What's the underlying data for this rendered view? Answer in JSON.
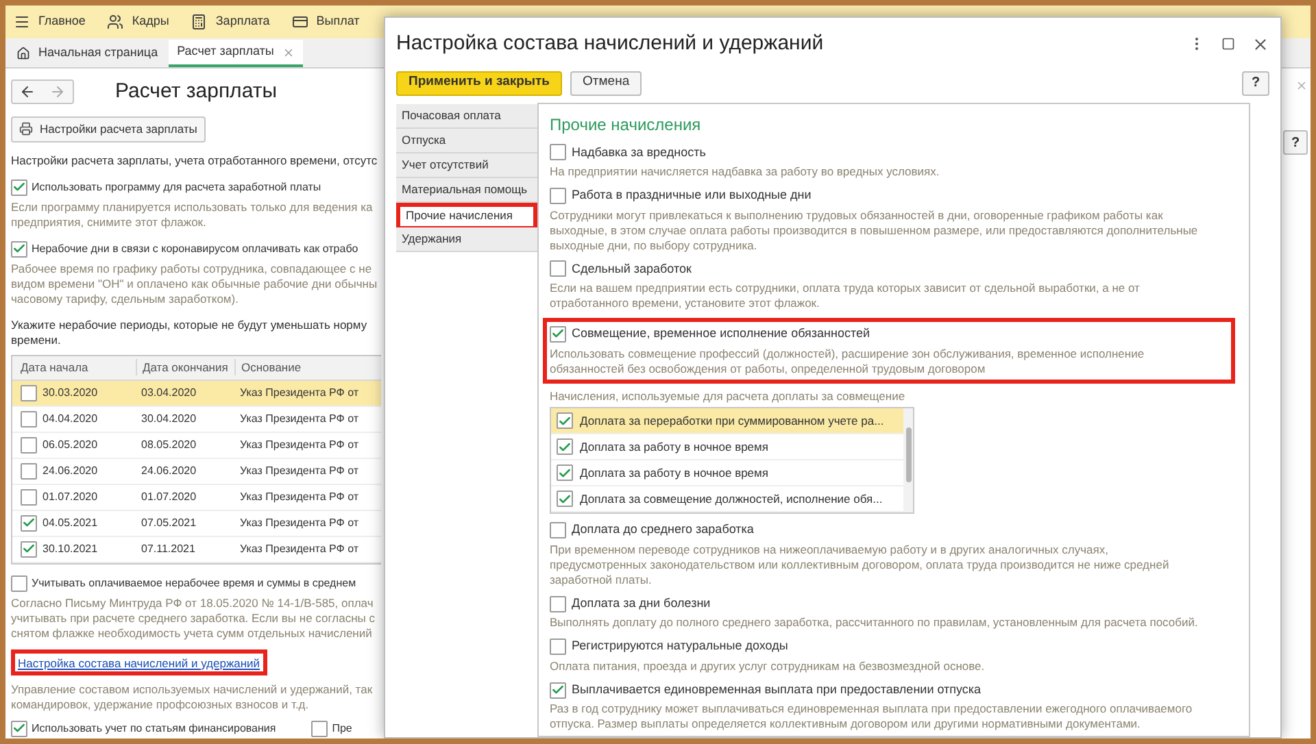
{
  "menu": [
    {
      "label": "Главное"
    },
    {
      "label": "Кадры"
    },
    {
      "label": "Зарплата"
    },
    {
      "label": "Выплат"
    }
  ],
  "tabs": [
    {
      "label": "Начальная страница",
      "selected": false
    },
    {
      "label": "Расчет зарплаты",
      "selected": true
    }
  ],
  "page": {
    "title": "Расчет зарплаты",
    "settings_button": "Настройки расчета зарплаты",
    "blocks": [
      {
        "kind": "text",
        "lines": [
          "Настройки расчета зарплаты, учета отработанного времени, отсутс"
        ]
      },
      {
        "kind": "checkbox",
        "label": "Использовать программу для расчета заработной платы",
        "checked": true,
        "hint": [
          "Если программу планируется использовать только для ведения ка",
          "предприятия, снимите этот флажок."
        ]
      },
      {
        "kind": "checkbox",
        "label": "Нерабочие дни в связи с коронавирусом оплачивать как отрабо",
        "checked": true,
        "hint": [
          "Рабочее время по графику работы сотрудника, совпадающее с не",
          "видом времени \"ОН\" и оплачено как обычные рабочие дни обычны",
          "часовому тарифу, сдельным заработком)."
        ]
      },
      {
        "kind": "text",
        "lines": [
          "Укажите нерабочие периоды, которые не будут уменьшать норму",
          "времени."
        ]
      },
      {
        "kind": "table",
        "columns": [
          "Дата начала",
          "Дата окончания",
          "Основание"
        ],
        "rows": [
          {
            "checked": false,
            "selected": true,
            "cells": [
              "30.03.2020",
              "03.04.2020",
              "Указ Президента РФ от"
            ]
          },
          {
            "checked": false,
            "selected": false,
            "cells": [
              "04.04.2020",
              "30.04.2020",
              "Указ Президента РФ от"
            ]
          },
          {
            "checked": false,
            "selected": false,
            "cells": [
              "06.05.2020",
              "08.05.2020",
              "Указ Президента РФ от"
            ]
          },
          {
            "checked": false,
            "selected": false,
            "cells": [
              "24.06.2020",
              "24.06.2020",
              "Указ Президента РФ от"
            ]
          },
          {
            "checked": false,
            "selected": false,
            "cells": [
              "01.07.2020",
              "01.07.2020",
              "Указ Президента РФ от"
            ]
          },
          {
            "checked": true,
            "selected": false,
            "cells": [
              "04.05.2021",
              "07.05.2021",
              "Указ Президента РФ от"
            ]
          },
          {
            "checked": true,
            "selected": false,
            "cells": [
              "30.10.2021",
              "07.11.2021",
              "Указ Президента РФ от"
            ]
          }
        ]
      },
      {
        "kind": "checkbox",
        "label": "Учитывать оплачиваемое нерабочее время и суммы в среднем",
        "checked": false,
        "hint": [
          "Согласно Письму Минтруда РФ от 18.05.2020 № 14-1/В-585, оплач",
          "учитывать при расчете среднего заработка. Если вы не согласны с",
          "снятом флажке необходимость учета сумм отдельных начислений"
        ]
      },
      {
        "kind": "link",
        "label": "Настройка состава начислений и удержаний",
        "highlighted": true,
        "hint": [
          "Управление составом используемых начислений и удержаний, так",
          "командировок, удержание профсоюзных взносов и т.д."
        ]
      },
      {
        "kind": "checkbox_row",
        "items": [
          {
            "label": "Использовать учет по статьям финансирования",
            "checked": true
          },
          {
            "label": "Пре",
            "checked": false
          }
        ]
      }
    ]
  },
  "right_help_button": "?",
  "dialog": {
    "title": "Настройка состава начислений и удержаний",
    "apply_button": "Применить и закрыть",
    "cancel_button": "Отмена",
    "help_button": "?",
    "sections": [
      {
        "label": "Почасовая оплата",
        "selected": false,
        "highlighted": false
      },
      {
        "label": "Отпуска",
        "selected": false,
        "highlighted": false
      },
      {
        "label": "Учет отсутствий",
        "selected": false,
        "highlighted": false
      },
      {
        "label": "Материальная помощь",
        "selected": false,
        "highlighted": false
      },
      {
        "label": "Прочие начисления",
        "selected": true,
        "highlighted": true
      },
      {
        "label": "Удержания",
        "selected": false,
        "highlighted": false
      }
    ],
    "heading": "Прочие начисления",
    "options": [
      {
        "label": "Надбавка за вредность",
        "checked": false,
        "highlighted": false,
        "hint": "На предприятии начисляется надбавка за работу во вредных условиях."
      },
      {
        "label": "Работа в праздничные или выходные дни",
        "checked": false,
        "highlighted": false,
        "hint": "Сотрудники могут привлекаться к выполнению трудовых обязанностей в дни, оговоренные графиком работы как выходные, в этом случае оплата работы производится в повышенном размере, или предоставляются дополнительные выходные дни, по выбору сотрудника."
      },
      {
        "label": "Сдельный заработок",
        "checked": false,
        "highlighted": false,
        "hint": "Если на вашем предприятии есть сотрудники, оплата труда которых зависит от сдельной выработки, а не от отработанного времени, установите этот флажок."
      },
      {
        "label": "Совмещение, временное исполнение обязанностей",
        "checked": true,
        "highlighted": true,
        "hint": "Использовать совмещение профессий (должностей), расширение зон обслуживания, временное исполнение обязанностей без освобождения от работы, определенной трудовым договором",
        "sub": {
          "label": "Начисления, используемые для расчета доплаты за совмещение",
          "items": [
            {
              "label": "Доплата за переработки при суммированном учете ра...",
              "checked": true,
              "selected": true
            },
            {
              "label": "Доплата за работу в ночное время",
              "checked": true,
              "selected": false
            },
            {
              "label": "Доплата за работу в ночное время",
              "checked": true,
              "selected": false
            },
            {
              "label": "Доплата за совмещение должностей, исполнение обя...",
              "checked": true,
              "selected": false
            }
          ]
        }
      },
      {
        "label": "Доплата до среднего заработка",
        "checked": false,
        "highlighted": false,
        "hint": "При временном переводе сотрудников на нижеоплачиваемую работу и в других аналогичных случаях, предусмотренных законодательством или коллективным договором, оплата труда производится не ниже средней заработной платы."
      },
      {
        "label": "Доплата за дни болезни",
        "checked": false,
        "highlighted": false,
        "hint": "Выполнять доплату до полного среднего заработка, рассчитанного по правилам, установленным для расчета пособий."
      },
      {
        "label": "Регистрируются натуральные доходы",
        "checked": false,
        "highlighted": false,
        "hint": "Оплата питания, проезда и других услуг сотрудникам на безвозмездной основе."
      },
      {
        "label": "Выплачивается единовременная выплата при предоставлении отпуска",
        "checked": true,
        "highlighted": false,
        "hint": "Раз в год сотруднику может выплачиваться единовременная выплата при предоставлении ежегодного оплачиваемого отпуска. Размер выплаты определяется коллективным договором или другими нормативными документами."
      }
    ]
  }
}
